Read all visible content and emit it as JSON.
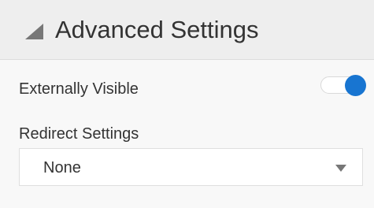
{
  "header": {
    "title": "Advanced Settings",
    "icon": "collapse-triangle-icon"
  },
  "externally_visible": {
    "label": "Externally Visible",
    "enabled": true,
    "accent_color": "#1875d1"
  },
  "redirect_settings": {
    "label": "Redirect Settings",
    "selected": "None",
    "icon": "chevron-down-icon"
  },
  "colors": {
    "header_background": "#eeeeee",
    "panel_background": "#f8f8f8",
    "text": "#333333",
    "icon_gray": "#777777"
  }
}
